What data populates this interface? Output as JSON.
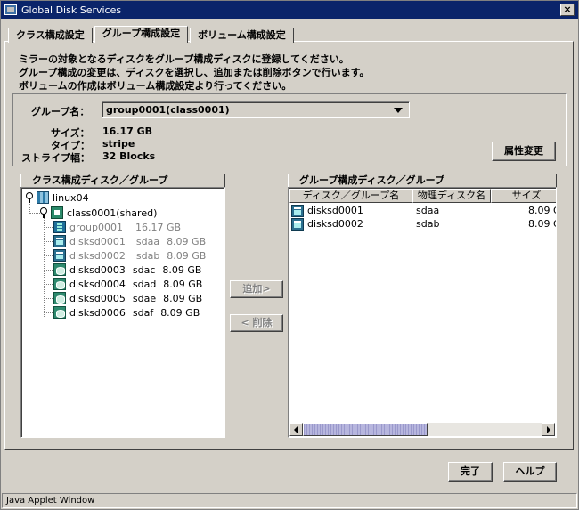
{
  "window": {
    "title": "Global Disk Services",
    "close_glyph": "×",
    "status": "Java Applet Window"
  },
  "tabs": [
    {
      "label": "クラス構成設定",
      "active": false
    },
    {
      "label": "グループ構成設定",
      "active": true
    },
    {
      "label": "ボリューム構成設定",
      "active": false
    }
  ],
  "description": [
    "ミラーの対象となるディスクをグループ構成ディスクに登録してください。",
    "グループ構成の変更は、ディスクを選択し、追加または削除ボタンで行います。",
    "ボリュームの作成はボリューム構成設定より行ってください。"
  ],
  "group": {
    "name_label": "グループ名：",
    "name_value": "group0001(class0001)",
    "size_label": "サイズ：",
    "size_value": "16.17 GB",
    "type_label": "タイプ：",
    "type_value": "stripe",
    "stripe_label": "ストライプ幅：",
    "stripe_value": "32 Blocks",
    "attr_button": "属性変更"
  },
  "left_pane": {
    "header": "クラス構成ディスク／グループ",
    "tree": {
      "host": {
        "label": "linux04",
        "icon": "host-icon"
      },
      "class": {
        "label": "class0001(shared)",
        "icon": "class-icon"
      },
      "items": [
        {
          "name": "group0001",
          "disk": "",
          "size": "16.17 GB",
          "dim": true,
          "icon": "group-icon"
        },
        {
          "name": "disksd0001",
          "disk": "sdaa",
          "size": "8.09 GB",
          "dim": true,
          "icon": "disk-in-group-icon"
        },
        {
          "name": "disksd0002",
          "disk": "sdab",
          "size": "8.09 GB",
          "dim": true,
          "icon": "disk-in-group-icon"
        },
        {
          "name": "disksd0003",
          "disk": "sdac",
          "size": "8.09 GB",
          "dim": false,
          "icon": "disk-icon"
        },
        {
          "name": "disksd0004",
          "disk": "sdad",
          "size": "8.09 GB",
          "dim": false,
          "icon": "disk-icon"
        },
        {
          "name": "disksd0005",
          "disk": "sdae",
          "size": "8.09 GB",
          "dim": false,
          "icon": "disk-icon"
        },
        {
          "name": "disksd0006",
          "disk": "sdaf",
          "size": "8.09 GB",
          "dim": false,
          "icon": "disk-icon"
        }
      ]
    }
  },
  "middle": {
    "add_button": "追加>",
    "remove_button": "< 削除"
  },
  "right_pane": {
    "header": "グループ構成ディスク／グループ",
    "columns": [
      "ディスク／グループ名",
      "物理ディスク名",
      "サイズ"
    ],
    "rows": [
      {
        "name": "disksd0001",
        "disk": "sdaa",
        "size": "8.09 G"
      },
      {
        "name": "disksd0002",
        "disk": "sdab",
        "size": "8.09 G"
      }
    ]
  },
  "footer": {
    "ok_button": "完了",
    "help_button": "ヘルプ"
  }
}
